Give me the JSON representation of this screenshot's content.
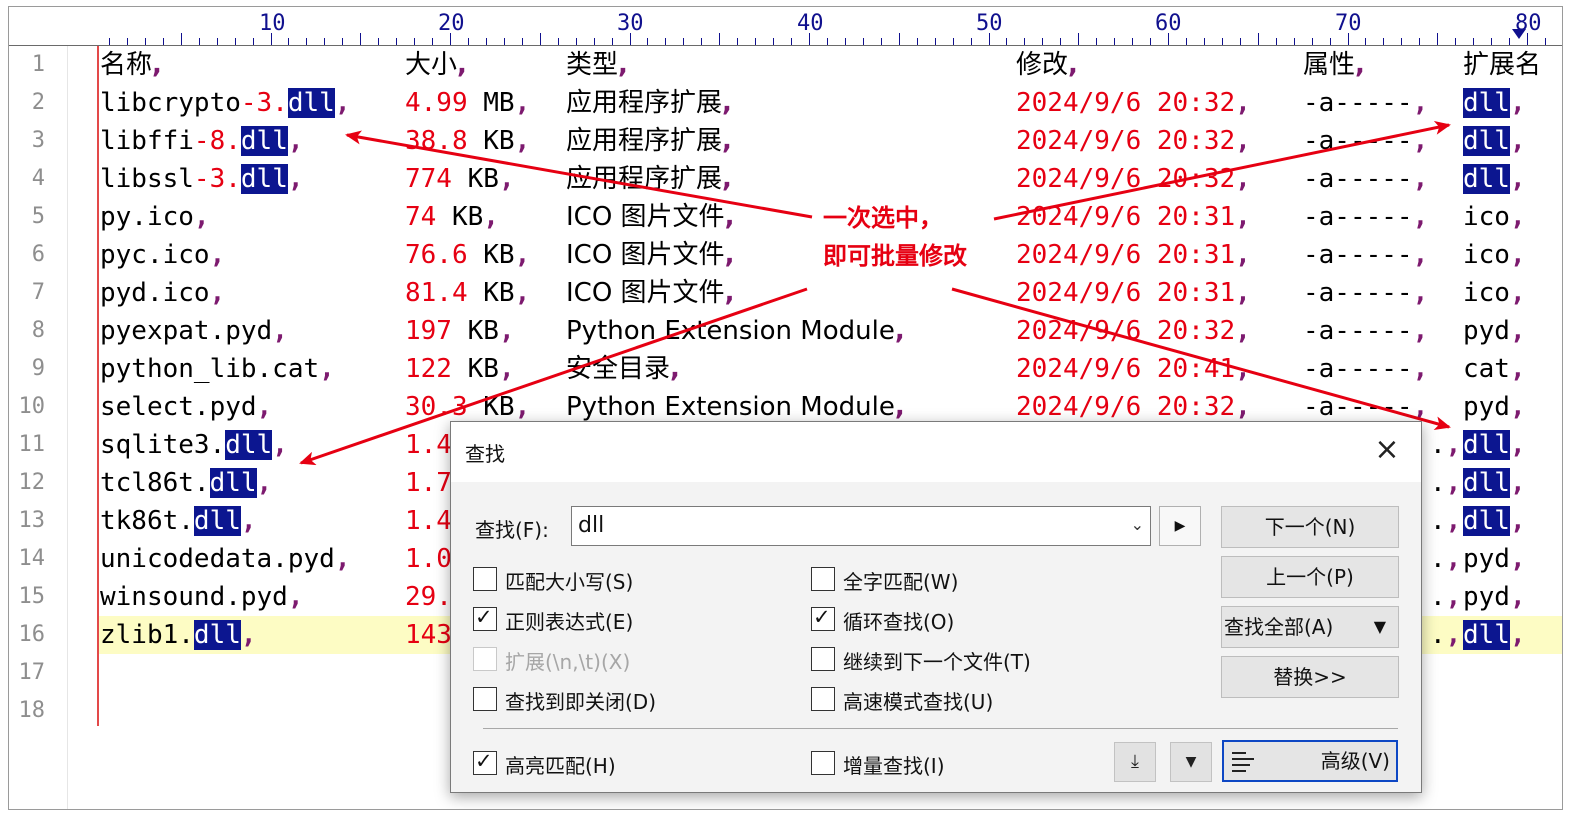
{
  "ruler": {
    "numbers": [
      "10",
      "20",
      "30",
      "40",
      "50",
      "60",
      "70",
      "80"
    ]
  },
  "line_numbers": [
    "1",
    "2",
    "3",
    "4",
    "5",
    "6",
    "7",
    "8",
    "9",
    "10",
    "11",
    "12",
    "13",
    "14",
    "15",
    "16",
    "17",
    "18"
  ],
  "rows": [
    {
      "name": "名称",
      "size": "大小",
      "type": "类型",
      "modified": "修改",
      "attr": "属性",
      "ext": "扩展名"
    },
    {
      "name_pre": "libcrypto",
      "name_num": "-3.",
      "name_sel": "dll",
      "size_num": "4.99",
      "size_unit": "MB",
      "type": "应用程序扩展",
      "modified": "2024/9/6 20:32",
      "attr": "-a-----",
      "ext": "dll",
      "ext_sel": true
    },
    {
      "name_pre": "libffi",
      "name_num": "-8.",
      "name_sel": "dll",
      "size_num": "38.8",
      "size_unit": "KB",
      "type": "应用程序扩展",
      "modified": "2024/9/6 20:32",
      "attr": "-a-----",
      "ext": "dll",
      "ext_sel": true
    },
    {
      "name_pre": "libssl",
      "name_num": "-3.",
      "name_sel": "dll",
      "size_num": "774",
      "size_unit": "KB",
      "type": "应用程序扩展",
      "modified": "2024/9/6 20:32",
      "attr": "-a-----",
      "ext": "dll",
      "ext_sel": true
    },
    {
      "name_pre": "py.ico",
      "size_num": "74",
      "size_unit": "KB",
      "type": "ICO 图片文件",
      "modified": "2024/9/6 20:31",
      "attr": "-a-----",
      "ext": "ico"
    },
    {
      "name_pre": "pyc.ico",
      "size_num": "76.6",
      "size_unit": "KB",
      "type": "ICO 图片文件",
      "modified": "2024/9/6 20:31",
      "attr": "-a-----",
      "ext": "ico"
    },
    {
      "name_pre": "pyd.ico",
      "size_num": "81.4",
      "size_unit": "KB",
      "type": "ICO 图片文件",
      "modified": "2024/9/6 20:31",
      "attr": "-a-----",
      "ext": "ico"
    },
    {
      "name_pre": "pyexpat.pyd",
      "size_num": "197",
      "size_unit": "KB",
      "type": "Python Extension Module",
      "modified": "2024/9/6 20:32",
      "attr": "-a-----",
      "ext": "pyd"
    },
    {
      "name_pre": "python_lib.cat",
      "size_num": "122",
      "size_unit": "KB",
      "type": "安全目录",
      "modified": "2024/9/6 20:41",
      "attr": "-a-----",
      "ext": "cat"
    },
    {
      "name_pre": "select.pyd",
      "size_num": "30.3",
      "size_unit": "KB",
      "type": "Python Extension Module",
      "modified": "2024/9/6 20:32",
      "attr": "-a-----",
      "ext": "pyd"
    },
    {
      "name_pre": "sqlite3.",
      "name_sel": "dll",
      "size_num": "1.4",
      "ext": "dll",
      "ext_sel": true
    },
    {
      "name_pre": "tcl86t.",
      "name_sel": "dll",
      "size_num": "1.7",
      "ext": "dll",
      "ext_sel": true
    },
    {
      "name_pre": "tk86t.",
      "name_sel": "dll",
      "size_num": "1.4",
      "ext": "dll",
      "ext_sel": true
    },
    {
      "name_pre": "unicodedata.pyd",
      "size_num": "1.0",
      "ext": "pyd"
    },
    {
      "name_pre": "winsound.pyd",
      "size_num": "29.",
      "ext": "pyd"
    },
    {
      "name_pre": "zlib1.",
      "name_sel": "dll",
      "size_num": "143",
      "ext": "dll",
      "ext_sel": true
    }
  ],
  "comma": ",",
  "annotation": {
    "line1": "一次选中，",
    "line2": "即可批量修改",
    "color": "#e60012"
  },
  "dialog": {
    "title": "查找",
    "close": "×",
    "find_label": "查找(F):",
    "find_value": "dll",
    "options_left": [
      {
        "label": "匹配大小写(S)",
        "checked": false,
        "disabled": false
      },
      {
        "label": "正则表达式(E)",
        "checked": true,
        "disabled": false
      },
      {
        "label": "扩展(\\n,\\t)(X)",
        "checked": false,
        "disabled": true
      },
      {
        "label": "查找到即关闭(D)",
        "checked": false,
        "disabled": false
      }
    ],
    "options_right": [
      {
        "label": "全字匹配(W)",
        "checked": false
      },
      {
        "label": "循环查找(O)",
        "checked": true
      },
      {
        "label": "继续到下一个文件(T)",
        "checked": false
      },
      {
        "label": "高速模式查找(U)",
        "checked": false
      }
    ],
    "buttons": {
      "next": "下一个(N)",
      "prev": "上一个(P)",
      "find_all": "查找全部(A)",
      "replace": "替换>>",
      "advanced": "高级(V)"
    },
    "bottom_left": {
      "label": "高亮匹配(H)",
      "checked": true
    },
    "bottom_right": {
      "label": "增量查找(I)",
      "checked": false
    }
  },
  "colors": {
    "selection": "#0c1690",
    "number": "#e60012",
    "comma": "#7d1a6f",
    "current_line": "#fdfcc4",
    "ruler": "#10108e"
  }
}
